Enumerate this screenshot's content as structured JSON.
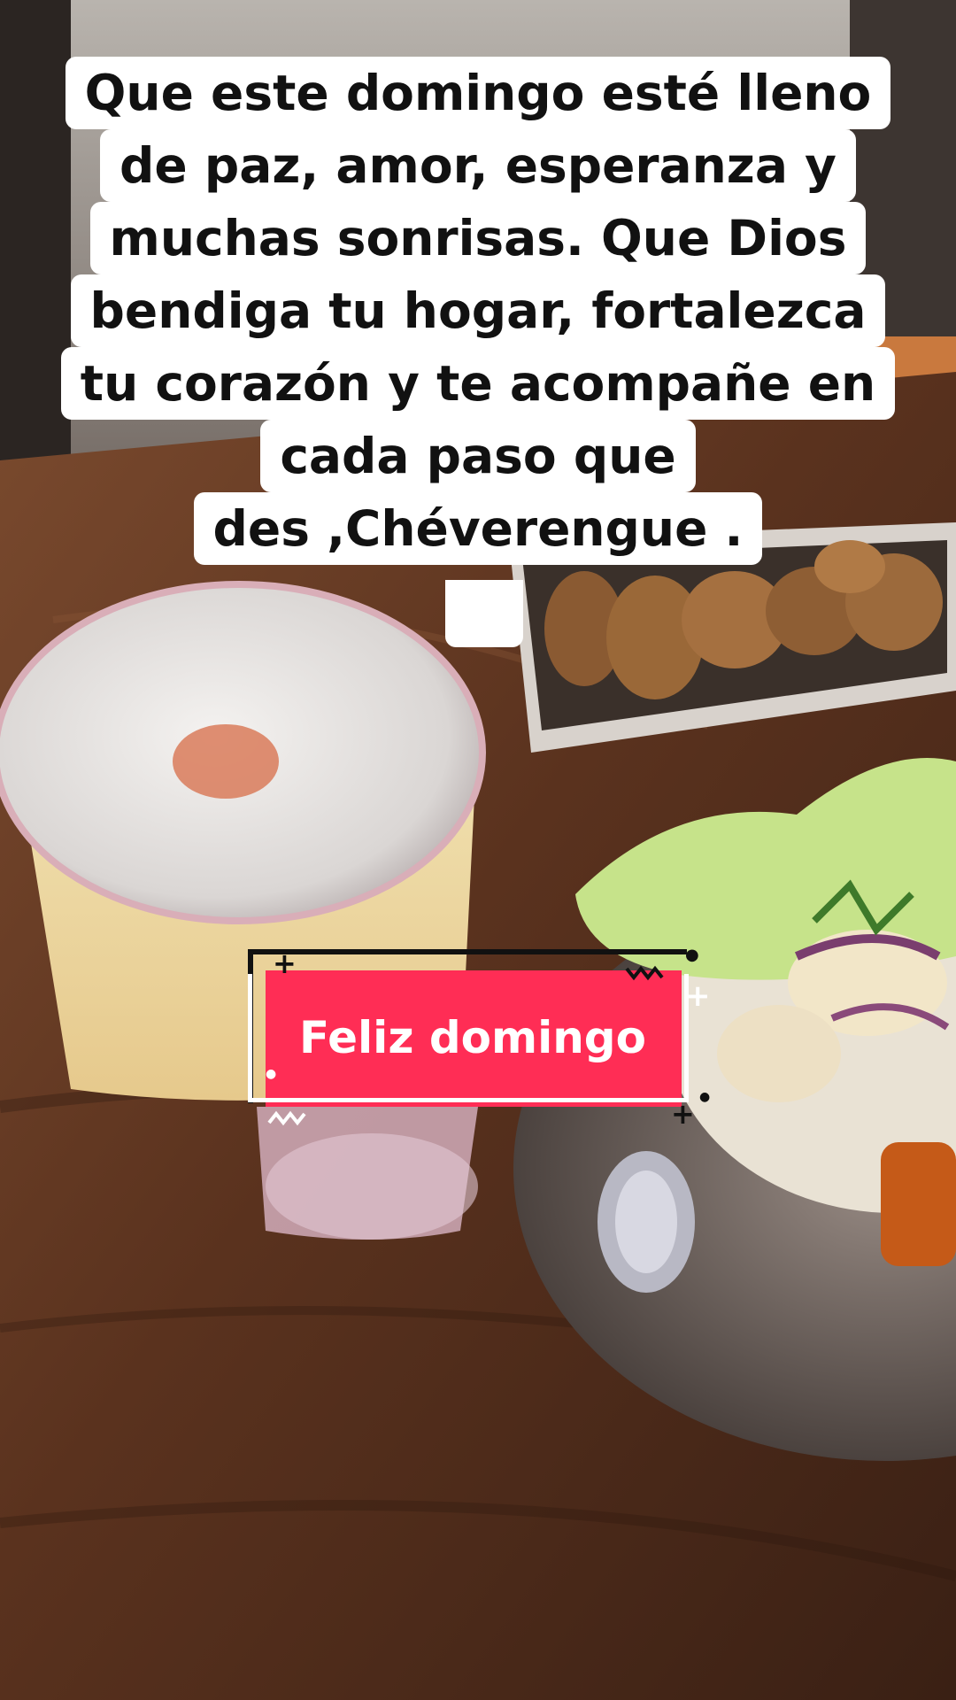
{
  "caption": {
    "lines": [
      "Que este domingo esté lleno",
      "de paz, amor, esperanza y",
      "muchas sonrisas. Que Dios",
      "bendiga tu hogar, fortalezca",
      "tu corazón y te acompañe en",
      "cada paso que",
      "des ,Chéverengue ."
    ]
  },
  "sticker": {
    "label": "Feliz domingo",
    "background_color": "#ff2d55",
    "text_color": "#ffffff"
  },
  "scene": {
    "items": [
      "pisco-sour-glass",
      "fried-wontons-plate",
      "ceviche-bowl",
      "wooden-table"
    ]
  },
  "colors": {
    "caption_background": "#ffffff",
    "caption_text": "#111111"
  }
}
